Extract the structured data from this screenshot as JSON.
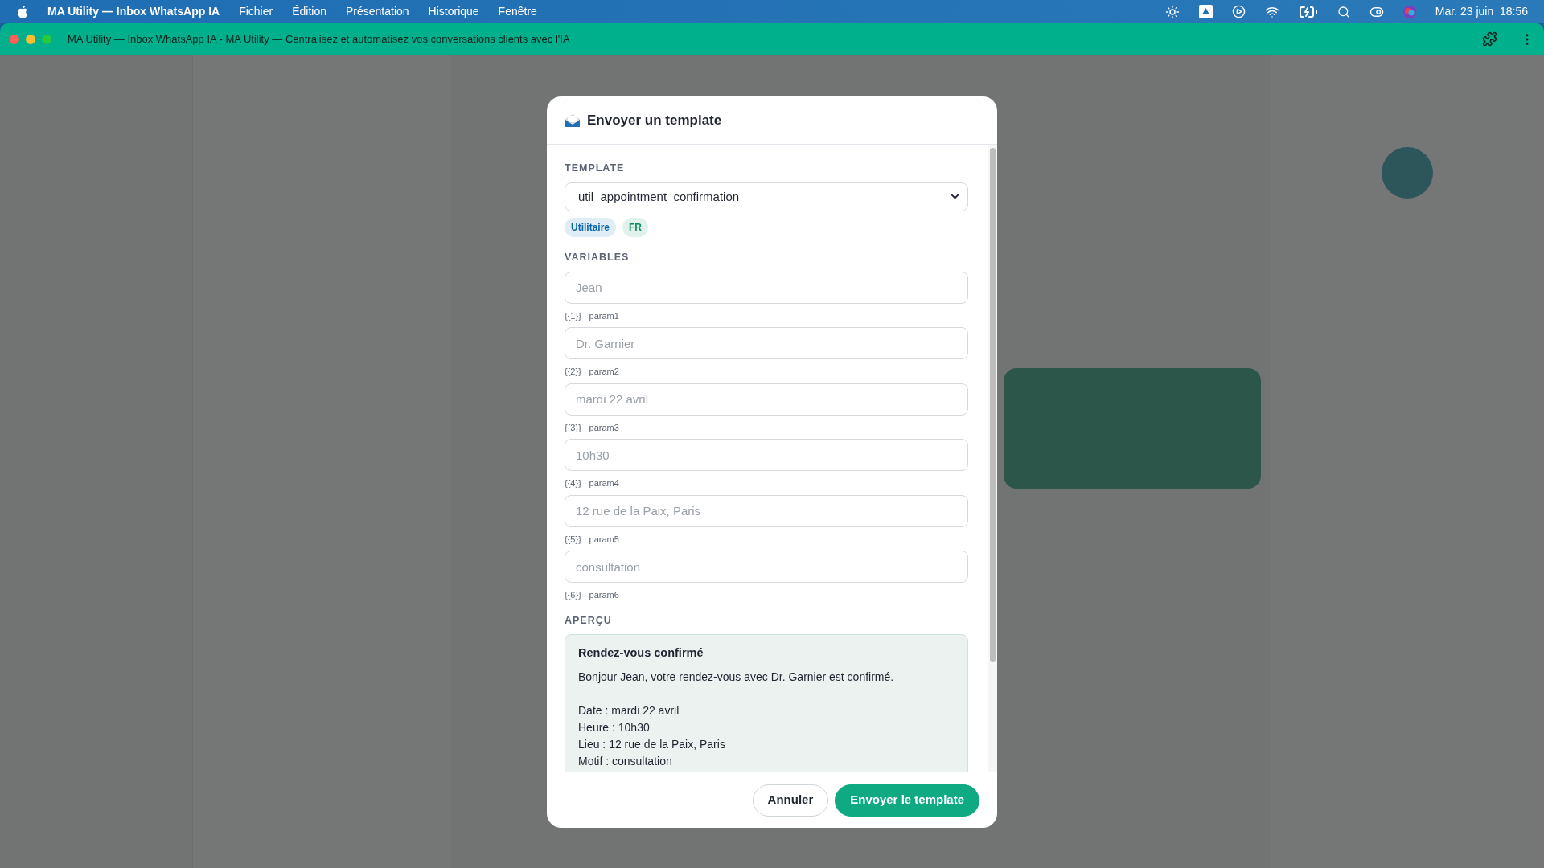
{
  "menubar": {
    "app_name": "MA Utility — Inbox WhatsApp IA",
    "menus": [
      "Fichier",
      "Édition",
      "Présentation",
      "Historique",
      "Fenêtre"
    ],
    "clock": "Mar. 23 juin  18:56"
  },
  "window": {
    "title": "MA Utility — Inbox WhatsApp IA - MA Utility — Centralisez et automatisez vos conversations clients avec l'IA"
  },
  "modal": {
    "title": "Envoyer un template",
    "template": {
      "label": "TEMPLATE",
      "value": "util_appointment_confirmation",
      "tags": [
        {
          "label": "Utilitaire",
          "color": "#0b67a8"
        },
        {
          "label": "FR",
          "color": "#0b8a63"
        }
      ]
    },
    "variables": {
      "label": "VARIABLES",
      "fields": [
        {
          "placeholder": "Jean",
          "hint": "{{1}} · param1"
        },
        {
          "placeholder": "Dr. Garnier",
          "hint": "{{2}} · param2"
        },
        {
          "placeholder": "mardi 22 avril",
          "hint": "{{3}} · param3"
        },
        {
          "placeholder": "10h30",
          "hint": "{{4}} · param4"
        },
        {
          "placeholder": "12 rue de la Paix, Paris",
          "hint": "{{5}} · param5"
        },
        {
          "placeholder": "consultation",
          "hint": "{{6}} · param6"
        }
      ]
    },
    "preview": {
      "label": "APERÇU",
      "title": "Rendez-vous confirmé",
      "body": "Bonjour Jean, votre rendez-vous avec Dr. Garnier est confirmé.\n\nDate : mardi 22 avril\nHeure : 10h30\nLieu : 12 rue de la Paix, Paris\nMotif : consultation"
    },
    "buttons": [
      {
        "label": "Annuler",
        "kind": "secondary"
      },
      {
        "label": "Envoyer le template",
        "kind": "primary"
      }
    ]
  }
}
